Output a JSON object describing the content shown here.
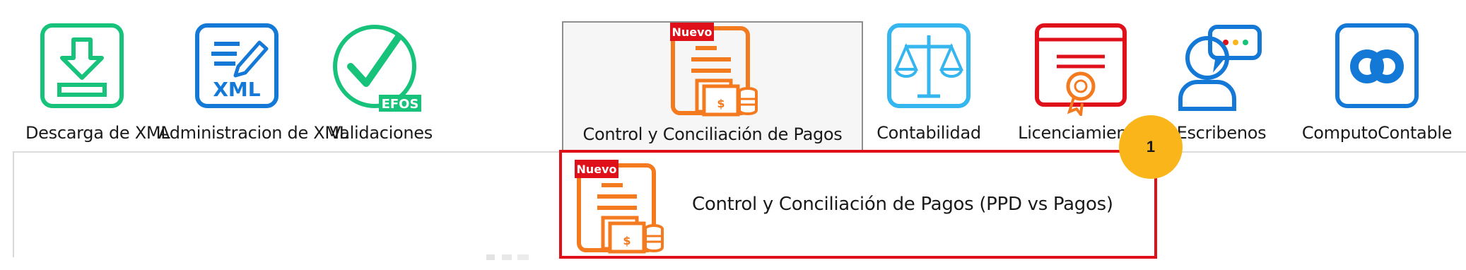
{
  "ribbon": {
    "items": [
      {
        "label": "Descarga de XML",
        "icon": "download-icon",
        "color": "#17c27a"
      },
      {
        "label": "Administracion de XML",
        "icon": "xml-edit-icon",
        "color": "#1479d6",
        "icon_text": "XML"
      },
      {
        "label": "Validaciones",
        "icon": "check-efos-icon",
        "color": "#17c27a",
        "icon_text": "EFOS"
      },
      {
        "label": "Control y Conciliación de Pagos",
        "icon": "payments-document-icon",
        "color": "#f47a1f",
        "badge": "Nuevo",
        "active": true
      },
      {
        "label": "Contabilidad",
        "icon": "balance-scale-icon",
        "color": "#36b6ee"
      },
      {
        "label": "Licenciamiento",
        "icon": "certificate-icon",
        "color": "#e0101a"
      },
      {
        "label": "Escribenos",
        "icon": "chat-person-icon",
        "color": "#1479d6"
      },
      {
        "label": "ComputoContable",
        "icon": "computocontable-logo-icon",
        "color": "#1479d6"
      }
    ]
  },
  "dropdown": {
    "item_label": "Control y Conciliación de Pagos (PPD vs Pagos)",
    "badge": "Nuevo",
    "highlight_color": "#e0101a"
  },
  "annotation": {
    "step": "1",
    "color": "#f9b51a"
  }
}
